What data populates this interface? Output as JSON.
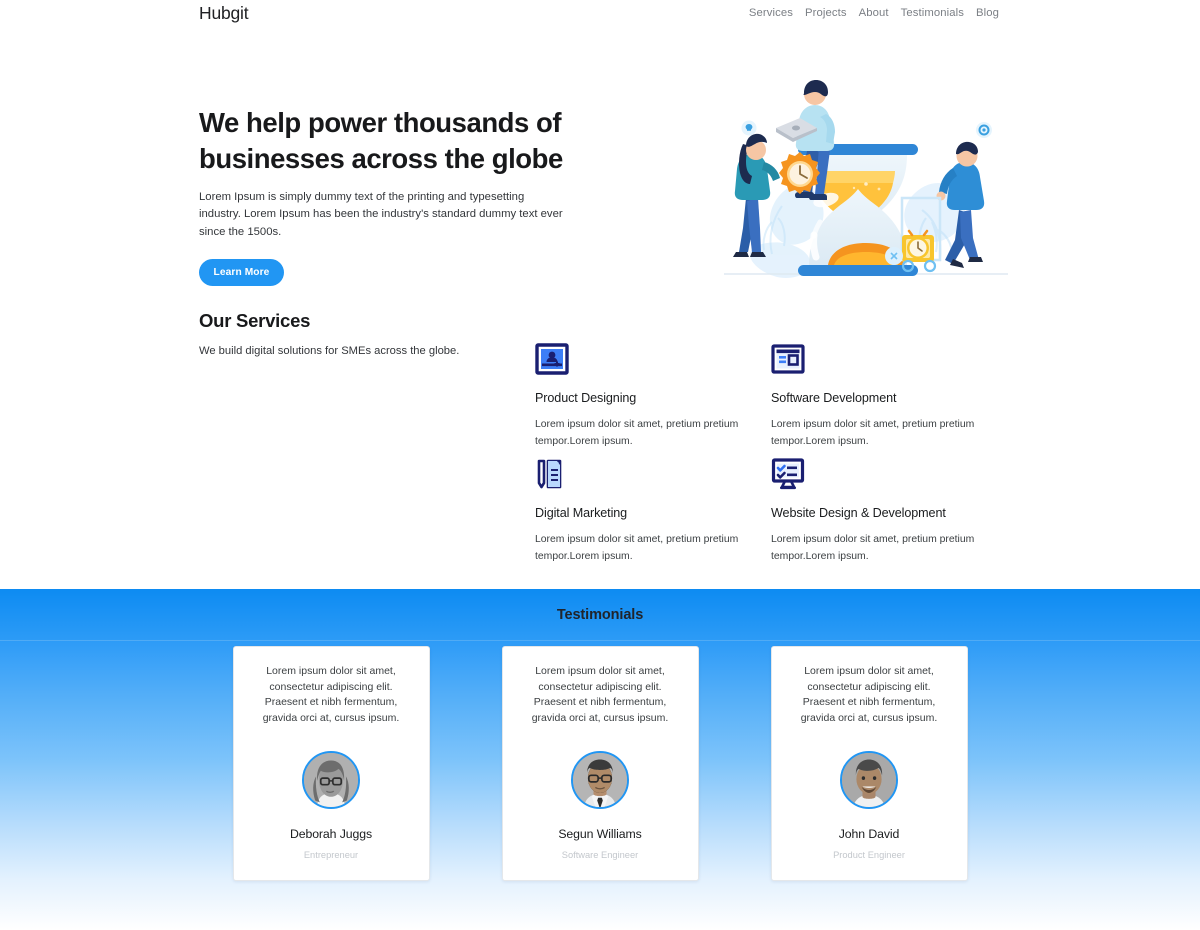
{
  "header": {
    "brand": "Hubgit",
    "nav": [
      {
        "label": "Services"
      },
      {
        "label": "Projects"
      },
      {
        "label": "About"
      },
      {
        "label": "Testimonials"
      },
      {
        "label": "Blog"
      }
    ]
  },
  "hero": {
    "title": "We help power thousands of businesses across the globe",
    "subtitle": "Lorem Ipsum is simply dummy text of the printing and typesetting industry. Lorem Ipsum has been the industry's standard dummy text ever since the 1500s.",
    "cta_label": "Learn More",
    "illustration_name": "hourglass-teamwork-illustration"
  },
  "services": {
    "title": "Our Services",
    "subtitle": "We build digital solutions for SMEs across the globe.",
    "items": [
      {
        "icon": "id-card-icon",
        "name": "Product Designing",
        "description": "Lorem ipsum dolor sit amet, pretium pretium tempor.Lorem ipsum."
      },
      {
        "icon": "browser-window-icon",
        "name": "Software Development",
        "description": "Lorem ipsum dolor sit amet, pretium pretium tempor.Lorem ipsum."
      },
      {
        "icon": "pen-document-icon",
        "name": "Digital Marketing",
        "description": "Lorem ipsum dolor sit amet, pretium pretium tempor.Lorem ipsum."
      },
      {
        "icon": "monitor-checklist-icon",
        "name": "Website Design & Development",
        "description": "Lorem ipsum dolor sit amet, pretium pretium tempor.Lorem ipsum."
      }
    ]
  },
  "testimonials": {
    "title": "Testimonials",
    "cards": [
      {
        "quote": "Lorem ipsum dolor sit amet, consectetur adipiscing elit. Praesent et nibh fermentum, gravida orci at, cursus ipsum.",
        "name": "Deborah Juggs",
        "role": "Entrepreneur",
        "avatar": "avatar-woman-glasses"
      },
      {
        "quote": "Lorem ipsum dolor sit amet, consectetur adipiscing elit. Praesent et nibh fermentum, gravida orci at, cursus ipsum.",
        "name": "Segun Williams",
        "role": "Software Engineer",
        "avatar": "avatar-man-glasses-tie"
      },
      {
        "quote": "Lorem ipsum dolor sit amet, consectetur adipiscing elit. Praesent et nibh fermentum, gravida orci at, cursus ipsum.",
        "name": "John David",
        "role": "Product Engineer",
        "avatar": "avatar-man-smiling"
      }
    ]
  },
  "colors": {
    "accent_blue": "#2196f3",
    "icon_navy": "#1a1f71",
    "icon_blue": "#2979ff",
    "testimonial_top": "#0d8bf2",
    "text_dark": "#18191b",
    "text_muted": "#7b7f85"
  }
}
